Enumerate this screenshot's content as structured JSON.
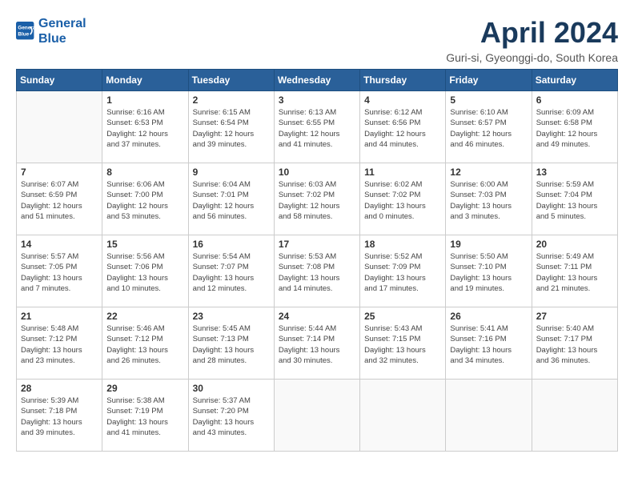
{
  "logo": {
    "line1": "General",
    "line2": "Blue"
  },
  "title": "April 2024",
  "subtitle": "Guri-si, Gyeonggi-do, South Korea",
  "headers": [
    "Sunday",
    "Monday",
    "Tuesday",
    "Wednesday",
    "Thursday",
    "Friday",
    "Saturday"
  ],
  "weeks": [
    [
      {
        "day": "",
        "info": ""
      },
      {
        "day": "1",
        "info": "Sunrise: 6:16 AM\nSunset: 6:53 PM\nDaylight: 12 hours\nand 37 minutes."
      },
      {
        "day": "2",
        "info": "Sunrise: 6:15 AM\nSunset: 6:54 PM\nDaylight: 12 hours\nand 39 minutes."
      },
      {
        "day": "3",
        "info": "Sunrise: 6:13 AM\nSunset: 6:55 PM\nDaylight: 12 hours\nand 41 minutes."
      },
      {
        "day": "4",
        "info": "Sunrise: 6:12 AM\nSunset: 6:56 PM\nDaylight: 12 hours\nand 44 minutes."
      },
      {
        "day": "5",
        "info": "Sunrise: 6:10 AM\nSunset: 6:57 PM\nDaylight: 12 hours\nand 46 minutes."
      },
      {
        "day": "6",
        "info": "Sunrise: 6:09 AM\nSunset: 6:58 PM\nDaylight: 12 hours\nand 49 minutes."
      }
    ],
    [
      {
        "day": "7",
        "info": "Sunrise: 6:07 AM\nSunset: 6:59 PM\nDaylight: 12 hours\nand 51 minutes."
      },
      {
        "day": "8",
        "info": "Sunrise: 6:06 AM\nSunset: 7:00 PM\nDaylight: 12 hours\nand 53 minutes."
      },
      {
        "day": "9",
        "info": "Sunrise: 6:04 AM\nSunset: 7:01 PM\nDaylight: 12 hours\nand 56 minutes."
      },
      {
        "day": "10",
        "info": "Sunrise: 6:03 AM\nSunset: 7:02 PM\nDaylight: 12 hours\nand 58 minutes."
      },
      {
        "day": "11",
        "info": "Sunrise: 6:02 AM\nSunset: 7:02 PM\nDaylight: 13 hours\nand 0 minutes."
      },
      {
        "day": "12",
        "info": "Sunrise: 6:00 AM\nSunset: 7:03 PM\nDaylight: 13 hours\nand 3 minutes."
      },
      {
        "day": "13",
        "info": "Sunrise: 5:59 AM\nSunset: 7:04 PM\nDaylight: 13 hours\nand 5 minutes."
      }
    ],
    [
      {
        "day": "14",
        "info": "Sunrise: 5:57 AM\nSunset: 7:05 PM\nDaylight: 13 hours\nand 7 minutes."
      },
      {
        "day": "15",
        "info": "Sunrise: 5:56 AM\nSunset: 7:06 PM\nDaylight: 13 hours\nand 10 minutes."
      },
      {
        "day": "16",
        "info": "Sunrise: 5:54 AM\nSunset: 7:07 PM\nDaylight: 13 hours\nand 12 minutes."
      },
      {
        "day": "17",
        "info": "Sunrise: 5:53 AM\nSunset: 7:08 PM\nDaylight: 13 hours\nand 14 minutes."
      },
      {
        "day": "18",
        "info": "Sunrise: 5:52 AM\nSunset: 7:09 PM\nDaylight: 13 hours\nand 17 minutes."
      },
      {
        "day": "19",
        "info": "Sunrise: 5:50 AM\nSunset: 7:10 PM\nDaylight: 13 hours\nand 19 minutes."
      },
      {
        "day": "20",
        "info": "Sunrise: 5:49 AM\nSunset: 7:11 PM\nDaylight: 13 hours\nand 21 minutes."
      }
    ],
    [
      {
        "day": "21",
        "info": "Sunrise: 5:48 AM\nSunset: 7:12 PM\nDaylight: 13 hours\nand 23 minutes."
      },
      {
        "day": "22",
        "info": "Sunrise: 5:46 AM\nSunset: 7:12 PM\nDaylight: 13 hours\nand 26 minutes."
      },
      {
        "day": "23",
        "info": "Sunrise: 5:45 AM\nSunset: 7:13 PM\nDaylight: 13 hours\nand 28 minutes."
      },
      {
        "day": "24",
        "info": "Sunrise: 5:44 AM\nSunset: 7:14 PM\nDaylight: 13 hours\nand 30 minutes."
      },
      {
        "day": "25",
        "info": "Sunrise: 5:43 AM\nSunset: 7:15 PM\nDaylight: 13 hours\nand 32 minutes."
      },
      {
        "day": "26",
        "info": "Sunrise: 5:41 AM\nSunset: 7:16 PM\nDaylight: 13 hours\nand 34 minutes."
      },
      {
        "day": "27",
        "info": "Sunrise: 5:40 AM\nSunset: 7:17 PM\nDaylight: 13 hours\nand 36 minutes."
      }
    ],
    [
      {
        "day": "28",
        "info": "Sunrise: 5:39 AM\nSunset: 7:18 PM\nDaylight: 13 hours\nand 39 minutes."
      },
      {
        "day": "29",
        "info": "Sunrise: 5:38 AM\nSunset: 7:19 PM\nDaylight: 13 hours\nand 41 minutes."
      },
      {
        "day": "30",
        "info": "Sunrise: 5:37 AM\nSunset: 7:20 PM\nDaylight: 13 hours\nand 43 minutes."
      },
      {
        "day": "",
        "info": ""
      },
      {
        "day": "",
        "info": ""
      },
      {
        "day": "",
        "info": ""
      },
      {
        "day": "",
        "info": ""
      }
    ]
  ]
}
